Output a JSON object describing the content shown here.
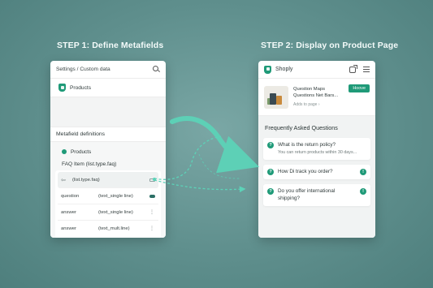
{
  "steps": {
    "step1_title": "STEP 1: Define Metafields",
    "step2_title": "STEP 2: Display on Product Page"
  },
  "left_panel": {
    "breadcrumb": "Settings / Custom data",
    "products_label": "Products",
    "definitions_label": "Metafield definitions",
    "definitions_products": "Products",
    "faq_item_title": "FAQ Item (list.type.faq)",
    "rows": [
      {
        "key": "",
        "value": "(list.type.faq)"
      },
      {
        "key": "question",
        "value": "(text_single line)"
      },
      {
        "key": "answer",
        "value": "(text_single line)"
      },
      {
        "key": "answer",
        "value": "(text_mult.line)"
      }
    ]
  },
  "right_panel": {
    "brand": "Shoply",
    "product_name": "Question Maps Questions Net Bars...",
    "product_sub": "Adds to page",
    "buy_label": "Hoove",
    "faq_heading": "Frequently Asked Questions",
    "faqs": [
      {
        "question": "What is the return policy?",
        "answer": "You can return products within 30 days..."
      },
      {
        "question": "How Di track you order?",
        "answer": ""
      },
      {
        "question": "Do you offer international shipping?",
        "answer": ""
      }
    ]
  },
  "colors": {
    "accent": "#1f9a78",
    "arrow": "#5cd3b8",
    "background": "#6a9997"
  }
}
